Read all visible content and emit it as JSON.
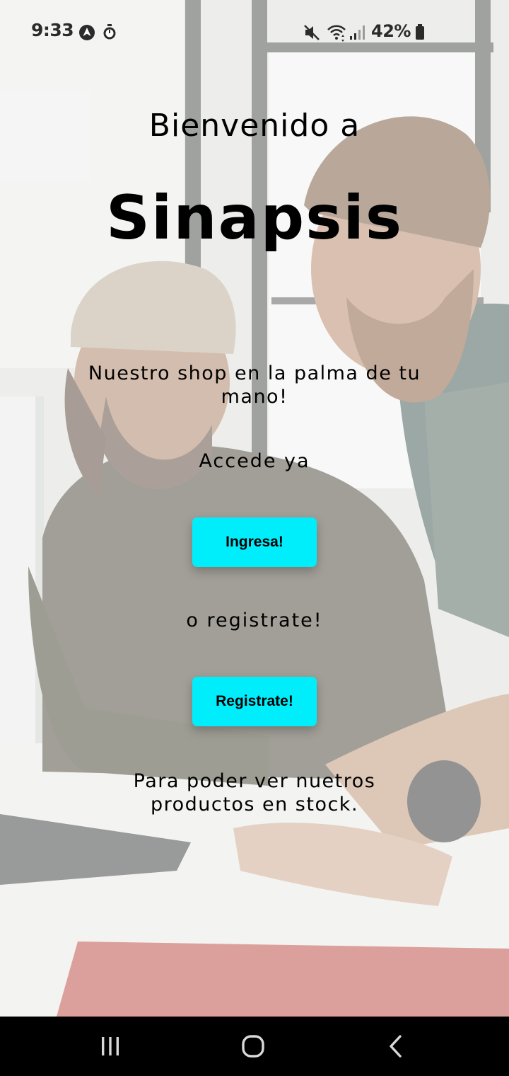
{
  "status_bar": {
    "time": "9:33",
    "battery_percent": "42%",
    "icons": [
      "navigation-arrow-icon",
      "timer-icon",
      "mute-icon",
      "wifi-icon",
      "signal-icon",
      "battery-icon"
    ]
  },
  "welcome": {
    "greeting": "Bienvenido a",
    "brand": "Sinapsis",
    "tagline": "Nuestro shop en la palma de tu mano!",
    "access_prompt": "Accede ya",
    "login_label": "Ingresa!",
    "or_register": "o registrate!",
    "register_label": "Registrate!",
    "footer_note": "Para poder ver nuetros productos en stock."
  },
  "colors": {
    "button_accent": "#00eefc",
    "text": "#000000",
    "nav_bar": "#000000"
  },
  "nav_bar": {
    "icons": [
      "recents-icon",
      "home-icon",
      "back-icon"
    ]
  }
}
